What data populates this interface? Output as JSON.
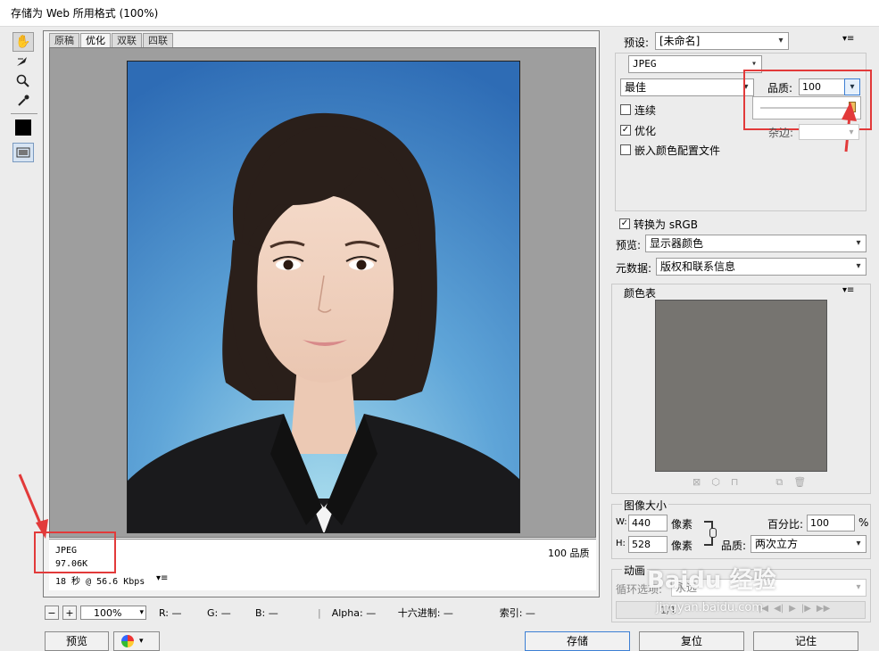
{
  "window": {
    "title": "存储为 Web 所用格式 (100%)"
  },
  "tabs": [
    {
      "label": "原稿"
    },
    {
      "label": "优化"
    },
    {
      "label": "双联"
    },
    {
      "label": "四联"
    }
  ],
  "info": {
    "format": "JPEG",
    "size": "97.06K",
    "time": "18 秒 @ 56.6 Kbps",
    "quality": "100 品质"
  },
  "status": {
    "zoom": "100%",
    "r": "R: —",
    "g": "G: —",
    "b": "B: —",
    "alpha": "Alpha: —",
    "hex": "十六进制: —",
    "index": "索引: —"
  },
  "buttons": {
    "preview": "预览",
    "save": "存储",
    "reset": "复位",
    "remember": "记住"
  },
  "settings": {
    "preset_label": "预设:",
    "preset_value": "[未命名]",
    "format_value": "JPEG",
    "compression_value": "最佳",
    "quality_label": "品质:",
    "quality_value": "100",
    "progressive": "连续",
    "optimized": "优化",
    "matte_label": "杂边:",
    "embed_profile": "嵌入颜色配置文件",
    "convert_srgb": "转换为 sRGB",
    "preview_label": "预览:",
    "preview_value": "显示器颜色",
    "metadata_label": "元数据:",
    "metadata_value": "版权和联系信息",
    "quality_slider_fraction": 1.0
  },
  "color_table": {
    "title": "颜色表",
    "swatch_color": "#767470"
  },
  "image_size": {
    "title": "图像大小",
    "w_label": "W:",
    "w_value": "440",
    "w_unit": "像素",
    "h_label": "H:",
    "h_value": "528",
    "h_unit": "像素",
    "percent_label": "百分比:",
    "percent_value": "100",
    "percent_unit": "%",
    "quality_label": "品质:",
    "quality_value": "两次立方"
  },
  "animation": {
    "title": "动画",
    "loop_label": "循环选项:",
    "loop_value": "永远",
    "frame": "1/1"
  },
  "watermark": "Baidu 经验",
  "watermark_sub": "jingyan.baidu.com"
}
